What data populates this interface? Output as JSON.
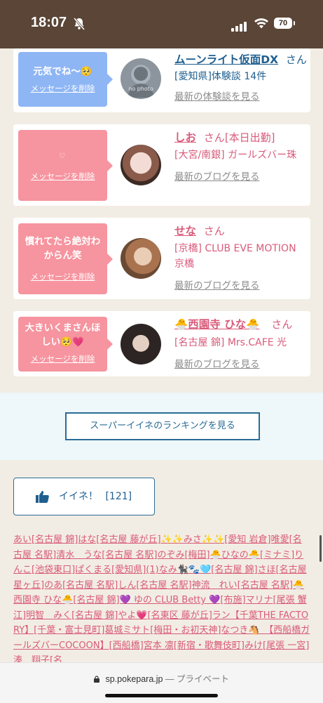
{
  "status_bar": {
    "time": "18:07",
    "battery": "70",
    "icons": [
      "bell-slash-icon",
      "signal-icon",
      "wifi-icon",
      "battery-icon"
    ]
  },
  "cards": [
    {
      "bubble_color": "#8fb6f4",
      "message": "元気でね〜🥺",
      "delete_label": "メッセージを削除",
      "name": "ムーンライト仮面DX",
      "san": "さん",
      "name_extra": "",
      "detail": "[愛知県]体験談 14件",
      "latest_label": "最新の体験談を見る",
      "avatar_text": "no photo"
    },
    {
      "bubble_color": "#f6949f",
      "message": "",
      "delete_label": "メッセージを削除",
      "name": "しお",
      "san": "さん",
      "name_extra": "[本日出勤]",
      "detail": "[大宮/南銀] ガールズバー珠",
      "latest_label": "最新のブログを見る",
      "avatar_text": ""
    },
    {
      "bubble_color": "#f6949f",
      "message": "慣れてたら絶対わからん笑",
      "delete_label": "メッセージを削除",
      "name": "せな",
      "san": "さん",
      "name_extra": "",
      "detail": "[京橋] CLUB EVE MOTION 京橋",
      "latest_label": "最新のブログを見る",
      "avatar_text": ""
    },
    {
      "bubble_color": "#f6949f",
      "message": "大きいくまさんほしい🥺💗",
      "delete_label": "メッセージを削除",
      "name": "🐣西園寺 ひな🐣",
      "san": "さん",
      "name_extra": "",
      "detail": "[名古屋 錦] Mrs.CAFE 光",
      "latest_label": "最新のブログを見る",
      "avatar_text": ""
    }
  ],
  "ranking_button": "スーパーイイネのランキングを見る",
  "like_button": {
    "label": "イイネ！",
    "count": "[121]"
  },
  "likers_text": "あい[名古屋 錦]はな[名古屋 藤が丘]✨✨みさ✨✨[愛知 岩倉]唯愛[名古屋 名駅]清水　うな[名古屋 名駅]のぞみ[梅田]🐣ひなの🐣[ミナミ]りんこ[池袋東口]ぱくまる[愛知県](1)なみ🐈‍⬛🐾🩵[名古屋 錦]さほ[名古屋 星ヶ丘]のあ[名古屋 名駅]しん[名古屋 名駅]神流　れい[名古屋 名駅]🐣西園寺 ひな🐣[名古屋 錦]💜 ゆの CLUB Betty 💜[布施]マリナ[尾張 蟹江]明智　みく[名古屋 錦]やよ💗[名東区 藤が丘]ラン【千葉THE FACTORY】[千葉・富士見町]葛城ミサト[梅田・お初天神]なつき🐴　【西船橋ガールズバーCOCOON】[西船橋]宮本 凛[新宿・歌舞伎町]みけ[尾張 一宮]湊　翔子[名",
  "url_bar": {
    "domain": "sp.pokepara.jp",
    "separator": "—",
    "mode": "プライベート"
  }
}
